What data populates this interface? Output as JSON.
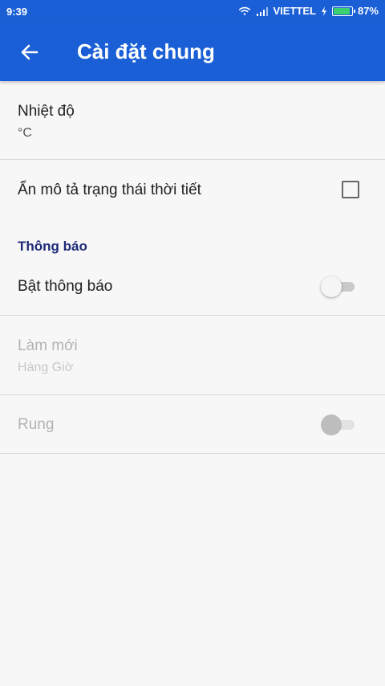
{
  "status_bar": {
    "time": "9:39",
    "carrier": "VIETTEL",
    "battery": "87%",
    "battery_level": 0.87
  },
  "app_bar": {
    "title": "Cài đặt chung",
    "back_icon": "arrow-left-icon"
  },
  "settings": {
    "temperature": {
      "label": "Nhiệt độ",
      "value": "°C"
    },
    "hide_weather_desc": {
      "label": "Ẩn mô tả trạng thái thời tiết",
      "checked": false
    },
    "notifications_header": "Thông báo",
    "enable_notifications": {
      "label": "Bật thông báo",
      "on": false
    },
    "refresh": {
      "label": "Làm mới",
      "value": "Hàng Giờ",
      "enabled": false
    },
    "vibrate": {
      "label": "Rung",
      "on": false,
      "enabled": false
    }
  },
  "colors": {
    "primary": "#1a5fd6",
    "section_header": "#1f2a78"
  }
}
